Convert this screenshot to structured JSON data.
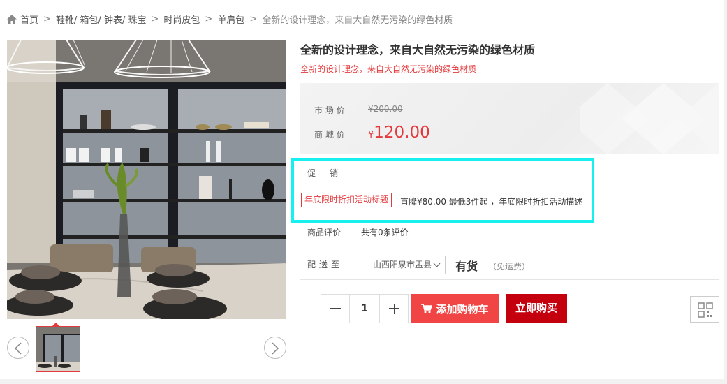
{
  "breadcrumb": {
    "home": "首页",
    "items": [
      "鞋靴/ 箱包/ 钟表/ 珠宝",
      "时尚皮包",
      "单肩包",
      "全新的设计理念，来自大自然无污染的绿色材质"
    ],
    "separator": ">"
  },
  "product": {
    "title": "全新的设计理念，来自大自然无污染的绿色材质",
    "subtitle": "全新的设计理念，来自大自然无污染的绿色材质"
  },
  "price": {
    "market_label": "市 场 价",
    "market_value": "¥200.00",
    "mall_label": "商 城 价",
    "currency": "¥",
    "mall_value": "120.00"
  },
  "promotion": {
    "label": "促销",
    "tag": "年底限时折扣活动标题",
    "description": "直降¥80.00 最低3件起 ，年底限时折扣活动描述"
  },
  "rating": {
    "label": "商品评价",
    "value": "共有0条评价"
  },
  "shipping": {
    "label": "配送至",
    "region": "山西阳泉市盂县",
    "stock": "有货",
    "fee": "（免运费）"
  },
  "purchase": {
    "quantity": "1",
    "add_cart": "添加购物车",
    "buy_now": "立即购买"
  },
  "colors": {
    "accent_red": "#e4393c",
    "cart_red": "#f14545",
    "buy_red": "#c5000e",
    "highlight_cyan": "#17f0ee"
  }
}
